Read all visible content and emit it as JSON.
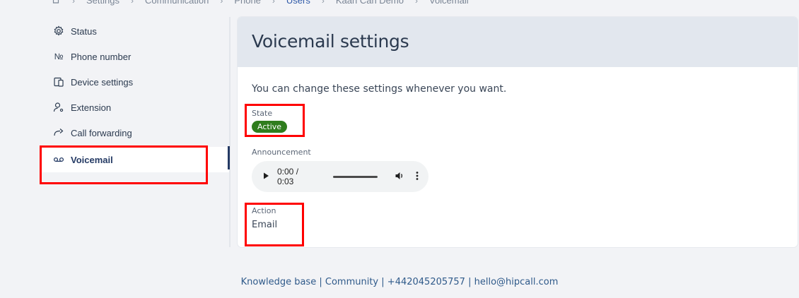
{
  "breadcrumb": {
    "items": [
      "Settings",
      "Communication",
      "Phone",
      "Users",
      "Kaan Can Demo",
      "Voicemail"
    ]
  },
  "sidebar": {
    "items": [
      {
        "label": "Status",
        "icon": "gear-icon"
      },
      {
        "label": "Phone number",
        "icon": "numero-icon"
      },
      {
        "label": "Device settings",
        "icon": "device-icon"
      },
      {
        "label": "Extension",
        "icon": "user-gear-icon"
      },
      {
        "label": "Call forwarding",
        "icon": "forward-icon"
      },
      {
        "label": "Voicemail",
        "icon": "voicemail-icon",
        "active": true
      }
    ]
  },
  "main": {
    "title": "Voicemail settings",
    "intro": "You can change these settings whenever you want.",
    "state_label": "State",
    "state_value": "Active",
    "announcement_label": "Announcement",
    "audio_time": "0:00 / 0:03",
    "action_label": "Action",
    "action_value": "Email"
  },
  "footer": {
    "knowledge": "Knowledge base",
    "community": "Community",
    "phone": "+442045205757",
    "email": "hello@hipcall.com",
    "sep": "|"
  },
  "colors": {
    "accent": "#243a64",
    "badge": "#2f7d1d",
    "annotation": "#ff0000"
  }
}
